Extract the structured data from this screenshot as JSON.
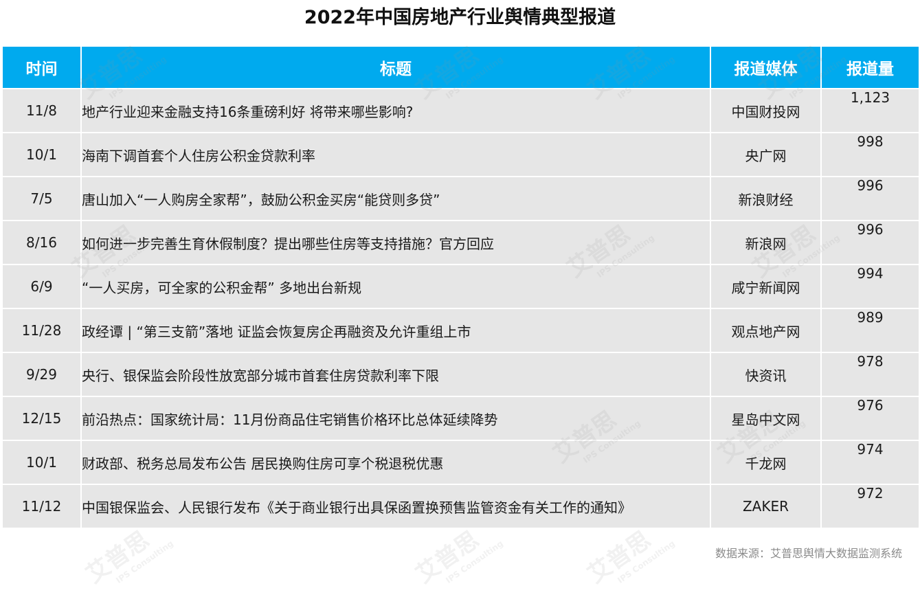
{
  "title": "2022年中国房地产行业舆情典型报道",
  "headers": {
    "time": "时间",
    "title": "标题",
    "media": "报道媒体",
    "count": "报道量"
  },
  "rows": [
    {
      "time": "11/8",
      "title": "地产行业迎来金融支持16条重磅利好 将带来哪些影响?",
      "media": "中国财投网",
      "count": "1,123"
    },
    {
      "time": "10/1",
      "title": "海南下调首套个人住房公积金贷款利率",
      "media": "央广网",
      "count": "998"
    },
    {
      "time": "7/5",
      "title": "唐山加入“一人购房全家帮”，鼓励公积金买房“能贷则多贷”",
      "media": "新浪财经",
      "count": "996"
    },
    {
      "time": "8/16",
      "title": "如何进一步完善生育休假制度？提出哪些住房等支持措施？官方回应",
      "media": "新浪网",
      "count": "996"
    },
    {
      "time": "6/9",
      "title": "“一人买房，可全家的公积金帮” 多地出台新规",
      "media": "咸宁新闻网",
      "count": "994"
    },
    {
      "time": "11/28",
      "title": "政经谭 | “第三支箭”落地 证监会恢复房企再融资及允许重组上市",
      "media": "观点地产网",
      "count": "989"
    },
    {
      "time": "9/29",
      "title": "央行、银保监会阶段性放宽部分城市首套住房贷款利率下限",
      "media": "快资讯",
      "count": "978"
    },
    {
      "time": "12/15",
      "title": "前沿热点：国家统计局：11月份商品住宅销售价格环比总体延续降势",
      "media": "星岛中文网",
      "count": "976"
    },
    {
      "time": "10/1",
      "title": "财政部、税务总局发布公告 居民换购住房可享个税退税优惠",
      "media": "千龙网",
      "count": "974"
    },
    {
      "time": "11/12",
      "title": "中国银保监会、人民银行发布《关于商业银行出具保函置换预售监管资金有关工作的通知》",
      "media": "ZAKER",
      "count": "972"
    }
  ],
  "footer": "数据来源：艾普思舆情大数据监测系统",
  "watermark": {
    "main": "艾普思",
    "sub": "IPS Consulting"
  },
  "colors": {
    "header_bg": "#00aaee",
    "row_bg": "#e6e6e6"
  }
}
